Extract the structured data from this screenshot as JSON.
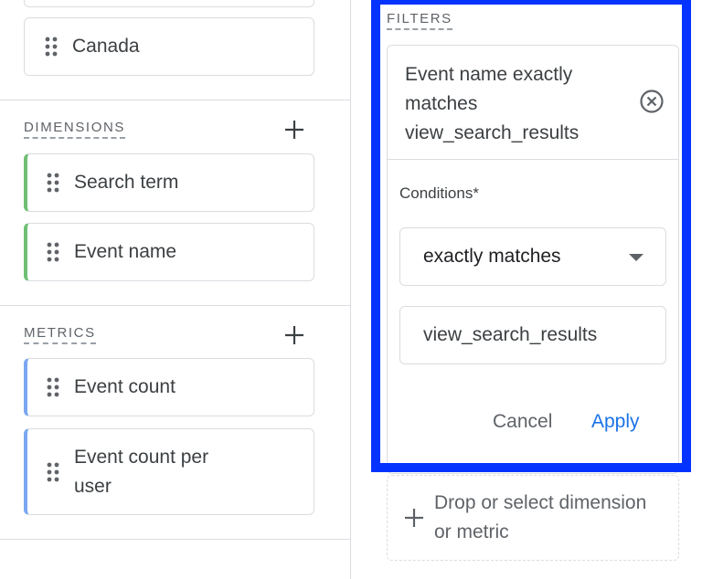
{
  "left_panel": {
    "top_chip": {
      "label": "Canada"
    },
    "dimensions": {
      "title": "DIMENSIONS",
      "add_icon": "plus-icon",
      "items": [
        {
          "label": "Search term"
        },
        {
          "label": "Event name"
        }
      ],
      "accent_color": "#6fbf73"
    },
    "metrics": {
      "title": "METRICS",
      "add_icon": "plus-icon",
      "items": [
        {
          "label": "Event count"
        },
        {
          "label": "Event count per user"
        }
      ],
      "accent_color": "#7aa7f0"
    }
  },
  "filters": {
    "title": "FILTERS",
    "summary": "Event name exactly matches view_search_results",
    "remove_icon": "cancel-circle-icon",
    "conditions_label": "Conditions*",
    "match_type": {
      "selected": "exactly matches"
    },
    "value_input": {
      "value": "view_search_results"
    },
    "cancel_label": "Cancel",
    "apply_label": "Apply",
    "highlight_color": "#0433ff",
    "apply_color": "#1a73e8"
  },
  "drop_zone": {
    "label": "Drop or select dimension or metric",
    "icon": "plus-icon"
  }
}
